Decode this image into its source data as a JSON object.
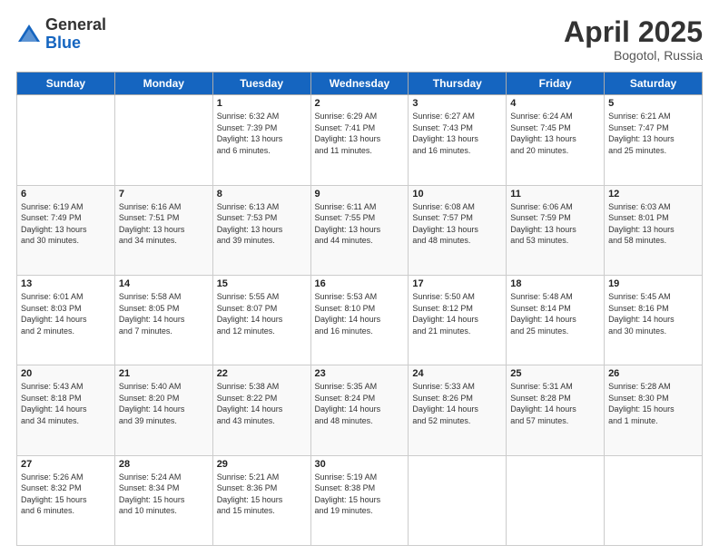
{
  "header": {
    "logo_general": "General",
    "logo_blue": "Blue",
    "month_title": "April 2025",
    "location": "Bogotol, Russia"
  },
  "days_of_week": [
    "Sunday",
    "Monday",
    "Tuesday",
    "Wednesday",
    "Thursday",
    "Friday",
    "Saturday"
  ],
  "weeks": [
    [
      {
        "day": "",
        "info": ""
      },
      {
        "day": "",
        "info": ""
      },
      {
        "day": "1",
        "info": "Sunrise: 6:32 AM\nSunset: 7:39 PM\nDaylight: 13 hours\nand 6 minutes."
      },
      {
        "day": "2",
        "info": "Sunrise: 6:29 AM\nSunset: 7:41 PM\nDaylight: 13 hours\nand 11 minutes."
      },
      {
        "day": "3",
        "info": "Sunrise: 6:27 AM\nSunset: 7:43 PM\nDaylight: 13 hours\nand 16 minutes."
      },
      {
        "day": "4",
        "info": "Sunrise: 6:24 AM\nSunset: 7:45 PM\nDaylight: 13 hours\nand 20 minutes."
      },
      {
        "day": "5",
        "info": "Sunrise: 6:21 AM\nSunset: 7:47 PM\nDaylight: 13 hours\nand 25 minutes."
      }
    ],
    [
      {
        "day": "6",
        "info": "Sunrise: 6:19 AM\nSunset: 7:49 PM\nDaylight: 13 hours\nand 30 minutes."
      },
      {
        "day": "7",
        "info": "Sunrise: 6:16 AM\nSunset: 7:51 PM\nDaylight: 13 hours\nand 34 minutes."
      },
      {
        "day": "8",
        "info": "Sunrise: 6:13 AM\nSunset: 7:53 PM\nDaylight: 13 hours\nand 39 minutes."
      },
      {
        "day": "9",
        "info": "Sunrise: 6:11 AM\nSunset: 7:55 PM\nDaylight: 13 hours\nand 44 minutes."
      },
      {
        "day": "10",
        "info": "Sunrise: 6:08 AM\nSunset: 7:57 PM\nDaylight: 13 hours\nand 48 minutes."
      },
      {
        "day": "11",
        "info": "Sunrise: 6:06 AM\nSunset: 7:59 PM\nDaylight: 13 hours\nand 53 minutes."
      },
      {
        "day": "12",
        "info": "Sunrise: 6:03 AM\nSunset: 8:01 PM\nDaylight: 13 hours\nand 58 minutes."
      }
    ],
    [
      {
        "day": "13",
        "info": "Sunrise: 6:01 AM\nSunset: 8:03 PM\nDaylight: 14 hours\nand 2 minutes."
      },
      {
        "day": "14",
        "info": "Sunrise: 5:58 AM\nSunset: 8:05 PM\nDaylight: 14 hours\nand 7 minutes."
      },
      {
        "day": "15",
        "info": "Sunrise: 5:55 AM\nSunset: 8:07 PM\nDaylight: 14 hours\nand 12 minutes."
      },
      {
        "day": "16",
        "info": "Sunrise: 5:53 AM\nSunset: 8:10 PM\nDaylight: 14 hours\nand 16 minutes."
      },
      {
        "day": "17",
        "info": "Sunrise: 5:50 AM\nSunset: 8:12 PM\nDaylight: 14 hours\nand 21 minutes."
      },
      {
        "day": "18",
        "info": "Sunrise: 5:48 AM\nSunset: 8:14 PM\nDaylight: 14 hours\nand 25 minutes."
      },
      {
        "day": "19",
        "info": "Sunrise: 5:45 AM\nSunset: 8:16 PM\nDaylight: 14 hours\nand 30 minutes."
      }
    ],
    [
      {
        "day": "20",
        "info": "Sunrise: 5:43 AM\nSunset: 8:18 PM\nDaylight: 14 hours\nand 34 minutes."
      },
      {
        "day": "21",
        "info": "Sunrise: 5:40 AM\nSunset: 8:20 PM\nDaylight: 14 hours\nand 39 minutes."
      },
      {
        "day": "22",
        "info": "Sunrise: 5:38 AM\nSunset: 8:22 PM\nDaylight: 14 hours\nand 43 minutes."
      },
      {
        "day": "23",
        "info": "Sunrise: 5:35 AM\nSunset: 8:24 PM\nDaylight: 14 hours\nand 48 minutes."
      },
      {
        "day": "24",
        "info": "Sunrise: 5:33 AM\nSunset: 8:26 PM\nDaylight: 14 hours\nand 52 minutes."
      },
      {
        "day": "25",
        "info": "Sunrise: 5:31 AM\nSunset: 8:28 PM\nDaylight: 14 hours\nand 57 minutes."
      },
      {
        "day": "26",
        "info": "Sunrise: 5:28 AM\nSunset: 8:30 PM\nDaylight: 15 hours\nand 1 minute."
      }
    ],
    [
      {
        "day": "27",
        "info": "Sunrise: 5:26 AM\nSunset: 8:32 PM\nDaylight: 15 hours\nand 6 minutes."
      },
      {
        "day": "28",
        "info": "Sunrise: 5:24 AM\nSunset: 8:34 PM\nDaylight: 15 hours\nand 10 minutes."
      },
      {
        "day": "29",
        "info": "Sunrise: 5:21 AM\nSunset: 8:36 PM\nDaylight: 15 hours\nand 15 minutes."
      },
      {
        "day": "30",
        "info": "Sunrise: 5:19 AM\nSunset: 8:38 PM\nDaylight: 15 hours\nand 19 minutes."
      },
      {
        "day": "",
        "info": ""
      },
      {
        "day": "",
        "info": ""
      },
      {
        "day": "",
        "info": ""
      }
    ]
  ]
}
